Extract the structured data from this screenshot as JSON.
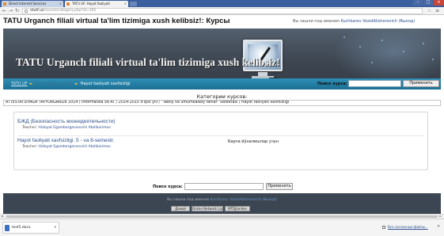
{
  "browser": {
    "tabs": [
      {
        "label": "Direct Internet Services"
      },
      {
        "label": "TATU UF: Hayot faoliyati"
      }
    ],
    "url_host": "etutf.uz",
    "url_path": "/course/category.php?id=105",
    "window_controls": {
      "minimize": "–",
      "maximize": "□",
      "close": "✕"
    }
  },
  "page": {
    "title": "TATU Urganch filiali virtual ta'lim tizimiga xush kelibsiz!: Курсы",
    "login": {
      "prefix": "Вы зашли под именем",
      "user": "Kuchkarov VoxidAlisherovich",
      "logout": "(Выход)"
    },
    "banner_title": "TATU Urganch filiali virtual ta'lim tizimiga xush kelibsiz!",
    "breadcrumb": {
      "home": "TATU UF",
      "courses": "Категории курсов",
      "current": "Hayot faoliyati xavfsizligi"
    },
    "nav_search": {
      "label": "Поиск курса:",
      "button": "Применить"
    },
    "categories_heading": "Категории курсов:",
    "category_path": "ATTESTATSIYAGA TAYYORGARLIK 2014 / Informatika va AT / 2014-2015 o'quv yili / \"Tabiiy va umumkasbiy fanlar\" kafedrasi / Hayot faoliyati xavfsizligi",
    "courses": [
      {
        "name": "БЖД (Безопасность жизнедеятельности)",
        "teacher_label": "Teacher:",
        "teacher": "Hidoyat Egambergansovich Abdikarimov",
        "summary": ""
      },
      {
        "name": "Hayot faoliyati xavfsizligi. 5 - va 8-semestr.",
        "teacher_label": "Teacher:",
        "teacher": "Hidoyat Egambergansovich Abdikarimov",
        "summary": "Барча йўналишлар учун"
      }
    ],
    "bottom_search": {
      "label": "Поиск курса:",
      "button": "Применить"
    },
    "footer": {
      "login_prefix": "Вы зашли под именем",
      "user": "Kuchkarov VoxidAlisherovich",
      "logout": "(Выход)",
      "buttons": [
        "Домой",
        "Online Network Layer",
        "MTDJ/online"
      ]
    }
  },
  "downloads": {
    "file": "test5.docx",
    "show_all": "Все скачанные файлы..."
  },
  "colors": {
    "navbar": "#1f7aa0",
    "banner": "#434d59",
    "link": "#2a4d8c",
    "footer": "#3c4652"
  }
}
